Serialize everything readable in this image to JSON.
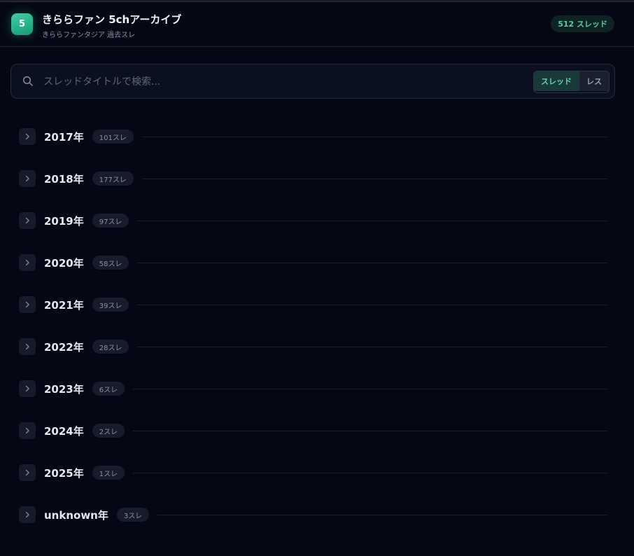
{
  "header": {
    "logo_text": "5",
    "title": "きららファン 5chアーカイブ",
    "subtitle": "きららファンタジア 過去スレ",
    "thread_count": "512 スレッド"
  },
  "search": {
    "placeholder": "スレッドタイトルで検索...",
    "value": "",
    "modes": [
      {
        "label": "スレッド",
        "active": true
      },
      {
        "label": "レス",
        "active": false
      }
    ]
  },
  "years": [
    {
      "label": "2017年",
      "count": "101スレ"
    },
    {
      "label": "2018年",
      "count": "177スレ"
    },
    {
      "label": "2019年",
      "count": "97スレ"
    },
    {
      "label": "2020年",
      "count": "58スレ"
    },
    {
      "label": "2021年",
      "count": "39スレ"
    },
    {
      "label": "2022年",
      "count": "28スレ"
    },
    {
      "label": "2023年",
      "count": "6スレ"
    },
    {
      "label": "2024年",
      "count": "2スレ"
    },
    {
      "label": "2025年",
      "count": "1スレ"
    },
    {
      "label": "unknown年",
      "count": "3スレ"
    }
  ],
  "icons": {
    "search": "search-icon",
    "expand": "chevron-right-icon"
  },
  "colors": {
    "background": "#050814",
    "accent": "#4fd1a6",
    "panel": "#0b1020"
  }
}
